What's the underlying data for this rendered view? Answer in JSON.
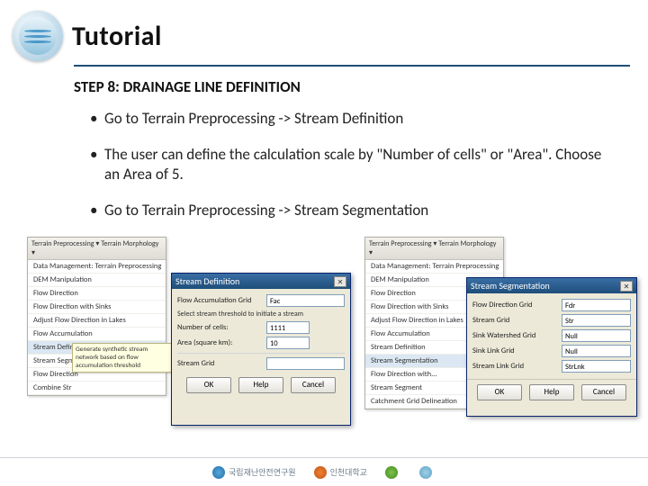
{
  "header": {
    "title": "Tutorial"
  },
  "step": {
    "title": "STEP 8: DRAINAGE LINE DEFINITION"
  },
  "bullets": [
    "Go to Terrain Preprocessing -> Stream Definition",
    "The user can define the calculation scale by \"Number of cells\" or \"Area\". Choose an Area of 5.",
    "Go to Terrain Preprocessing -> Stream Segmentation"
  ],
  "left_menu": {
    "toolbar": "Terrain Preprocessing ▾   Terrain Morphology ▾",
    "items": [
      "Data Management: Terrain Preprocessing",
      "DEM Manipulation",
      "Flow Direction",
      "Flow Direction with Sinks",
      "Adjust Flow Direction in Lakes",
      "Flow Accumulation",
      "Stream Definition",
      "Stream Segmentation",
      "Flow Direction",
      "Combine Str"
    ],
    "highlight_index": 6
  },
  "right_menu": {
    "toolbar": "Terrain Preprocessing ▾   Terrain Morphology ▾",
    "items": [
      "Data Management: Terrain Preprocessing",
      "DEM Manipulation",
      "Flow Direction",
      "Flow Direction with Sinks",
      "Adjust Flow Direction in Lakes",
      "Flow Accumulation",
      "Stream Definition",
      "Stream Segmentation",
      "Flow Direction with...",
      "Stream Segment",
      "Catchment Grid Delineation"
    ],
    "highlight_index": 7
  },
  "tooltip": "Generate synthetic stream network based on flow accumulation threshold",
  "stream_dialog": {
    "title": "Stream Definition",
    "flow_acc_label": "Flow Accumulation Grid",
    "flow_acc_value": "Fac",
    "threshold_label": "Select stream threshold to initiate a stream",
    "num_cells_label": "Number of cells:",
    "num_cells_value": "1111",
    "area_label": "Area (square km):",
    "area_value": "10",
    "stream_grid_label": "Stream Grid",
    "stream_grid_value": "",
    "ok": "OK",
    "help": "Help",
    "cancel": "Cancel"
  },
  "seg_dialog": {
    "title": "Stream Segmentation",
    "rows": [
      {
        "label": "Flow Direction Grid",
        "value": "Fdr"
      },
      {
        "label": "Stream Grid",
        "value": "Str"
      },
      {
        "label": "Sink Watershed Grid",
        "value": "Null"
      },
      {
        "label": "Sink Link Grid",
        "value": "Null"
      },
      {
        "label": "Stream Link Grid",
        "value": "StrLnk"
      }
    ],
    "ok": "OK",
    "help": "Help",
    "cancel": "Cancel"
  },
  "footer": {
    "items": [
      "국립재난안전연구원",
      "인천대학교",
      "",
      ""
    ]
  }
}
